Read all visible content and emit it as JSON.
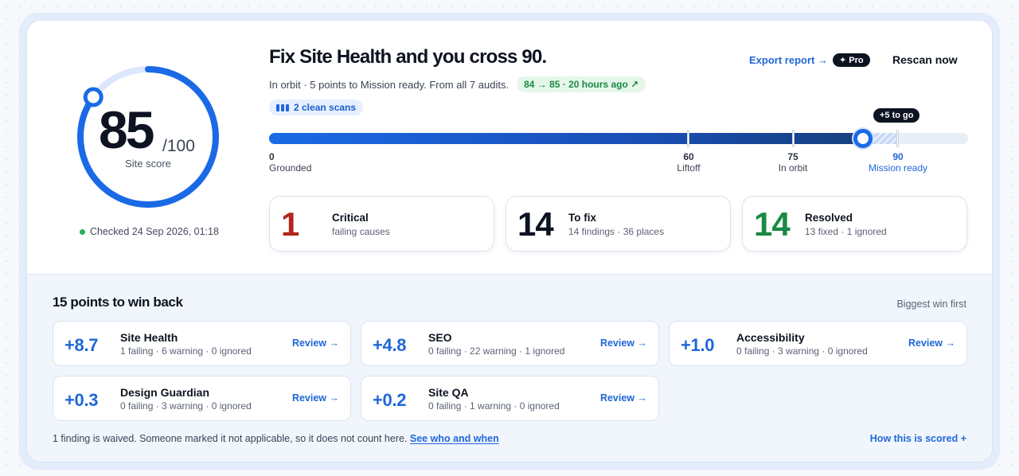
{
  "score": {
    "value": "85",
    "max": "/100",
    "label": "Site score",
    "fraction": 0.85,
    "checked": "Checked 24 Sep 2026, 01:18"
  },
  "header": {
    "title": "Fix Site Health and you cross 90.",
    "subtitle": "In orbit · 5 points to Mission ready. From all 7 audits.",
    "delta": "84 → 85 · 20 hours ago ↗",
    "clean_scans": "2 clean scans",
    "export_label": "Export report →",
    "pro_badge": "✦ Pro",
    "rescan_label": "Rescan now"
  },
  "progress": {
    "value": 85,
    "target": 90,
    "max": 100,
    "togo": "+5 to go",
    "milestones": [
      {
        "value": "0",
        "label": "Grounded"
      },
      {
        "value": "60",
        "label": "Liftoff"
      },
      {
        "value": "75",
        "label": "In orbit"
      },
      {
        "value": "90",
        "label": "Mission ready"
      }
    ]
  },
  "stats": [
    {
      "number": "1",
      "title": "Critical",
      "desc": "failing causes",
      "color": "#b3261e"
    },
    {
      "number": "14",
      "title": "To fix",
      "desc": "14 findings · 36 places",
      "color": "#0d1320"
    },
    {
      "number": "14",
      "title": "Resolved",
      "desc": "13 fixed · 1 ignored",
      "color": "#1a8a44"
    }
  ],
  "winback": {
    "title": "15 points to win back",
    "sort": "Biggest win first",
    "audits": [
      {
        "points": "+8.7",
        "name": "Site Health",
        "meta": "1 failing · 6 warning · 0 ignored",
        "action": "Review →"
      },
      {
        "points": "+4.8",
        "name": "SEO",
        "meta": "0 failing · 22 warning · 1 ignored",
        "action": "Review →"
      },
      {
        "points": "+1.0",
        "name": "Accessibility",
        "meta": "0 failing · 3 warning · 0 ignored",
        "action": "Review →"
      },
      {
        "points": "+0.3",
        "name": "Design Guardian",
        "meta": "0 failing · 3 warning · 0 ignored",
        "action": "Review →"
      },
      {
        "points": "+0.2",
        "name": "Site QA",
        "meta": "0 failing · 1 warning · 0 ignored",
        "action": "Review →"
      }
    ],
    "note": "1 finding is waived. Someone marked it not applicable, so it does not count here.",
    "note_link": "See who and when",
    "how": "How this is scored  +"
  },
  "colors": {
    "accent": "#1f67d8",
    "success": "#1a8a44",
    "critical": "#b3261e"
  }
}
